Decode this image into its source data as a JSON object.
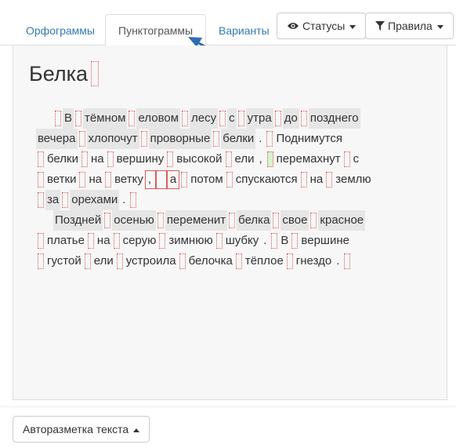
{
  "tabs": [
    {
      "label": "Орфограммы"
    },
    {
      "label": "Пунктограммы"
    },
    {
      "label": "Варианты"
    }
  ],
  "buttons": {
    "statuses_label": "Статусы",
    "rules_label": "Правила",
    "automarkup_label": "Авторазметка текста"
  },
  "icons": {
    "statuses": "eye-icon",
    "rules": "filter-icon"
  },
  "colors": {
    "accent": "#337ab7",
    "slot_border": "#e05a5a",
    "highlight_grey": "#e6e6e6",
    "highlight_green": "#d8f2d0"
  },
  "document": {
    "title": "Белка",
    "lines": [
      [
        {
          "t": "s"
        },
        {
          "t": "w",
          "v": "В"
        },
        {
          "t": "s"
        },
        {
          "t": "w",
          "v": "тёмном"
        },
        {
          "t": "s"
        },
        {
          "t": "w",
          "v": "еловом"
        },
        {
          "t": "s"
        },
        {
          "t": "w",
          "v": "лесу"
        },
        {
          "t": "s"
        },
        {
          "t": "w",
          "v": "с"
        },
        {
          "t": "s"
        },
        {
          "t": "w",
          "v": "утра"
        },
        {
          "t": "s"
        },
        {
          "t": "w",
          "v": "до"
        },
        {
          "t": "s"
        },
        {
          "t": "w",
          "v": "позднего"
        }
      ],
      [
        {
          "t": "w",
          "v": "вечера"
        },
        {
          "t": "s"
        },
        {
          "t": "w",
          "v": "хлопочут"
        },
        {
          "t": "s"
        },
        {
          "t": "w",
          "v": "проворные"
        },
        {
          "t": "s"
        },
        {
          "t": "w",
          "v": "белки"
        },
        {
          "t": "p",
          "v": "."
        },
        {
          "t": "s"
        },
        {
          "t": "w",
          "v": "Поднимутся"
        }
      ],
      [
        {
          "t": "s"
        },
        {
          "t": "w",
          "v": "белки"
        },
        {
          "t": "s"
        },
        {
          "t": "w",
          "v": "на"
        },
        {
          "t": "s"
        },
        {
          "t": "w",
          "v": "вершину"
        },
        {
          "t": "s"
        },
        {
          "t": "w",
          "v": "высокой"
        },
        {
          "t": "s"
        },
        {
          "t": "w",
          "v": "ели"
        },
        {
          "t": "p",
          "v": ","
        },
        {
          "t": "s",
          "g": true
        },
        {
          "t": "w",
          "v": "перемахнут"
        },
        {
          "t": "s"
        },
        {
          "t": "w",
          "v": "с"
        }
      ],
      [
        {
          "t": "s"
        },
        {
          "t": "w",
          "v": "ветки"
        },
        {
          "t": "s"
        },
        {
          "t": "w",
          "v": "на"
        },
        {
          "t": "s"
        },
        {
          "t": "w",
          "v": "ветку"
        },
        {
          "t": "b",
          "v": ","
        },
        {
          "t": "b",
          "v": ""
        },
        {
          "t": "b",
          "v": "а"
        },
        {
          "t": "s"
        },
        {
          "t": "w",
          "v": "потом"
        },
        {
          "t": "s"
        },
        {
          "t": "w",
          "v": "спускаются"
        },
        {
          "t": "s"
        },
        {
          "t": "w",
          "v": "на"
        },
        {
          "t": "s"
        },
        {
          "t": "w",
          "v": "землю"
        }
      ],
      [
        {
          "t": "s"
        },
        {
          "t": "w",
          "v": "за"
        },
        {
          "t": "s"
        },
        {
          "t": "w",
          "v": "орехами"
        },
        {
          "t": "p",
          "v": "."
        },
        {
          "t": "s"
        }
      ],
      [
        {
          "t": "w",
          "v": "Поздней",
          "ind": true
        },
        {
          "t": "s"
        },
        {
          "t": "w",
          "v": "осенью"
        },
        {
          "t": "s"
        },
        {
          "t": "w",
          "v": "переменит"
        },
        {
          "t": "s"
        },
        {
          "t": "w",
          "v": "белка"
        },
        {
          "t": "s"
        },
        {
          "t": "w",
          "v": "свое"
        },
        {
          "t": "s"
        },
        {
          "t": "w",
          "v": "красное"
        }
      ],
      [
        {
          "t": "s"
        },
        {
          "t": "w",
          "v": "платье"
        },
        {
          "t": "s"
        },
        {
          "t": "w",
          "v": "на"
        },
        {
          "t": "s"
        },
        {
          "t": "w",
          "v": "серую"
        },
        {
          "t": "s"
        },
        {
          "t": "w",
          "v": "зимнюю"
        },
        {
          "t": "s"
        },
        {
          "t": "w",
          "v": "шубку"
        },
        {
          "t": "p",
          "v": "."
        },
        {
          "t": "s"
        },
        {
          "t": "w",
          "v": "В"
        },
        {
          "t": "s"
        },
        {
          "t": "w",
          "v": "вершине"
        }
      ],
      [
        {
          "t": "s"
        },
        {
          "t": "w",
          "v": "густой"
        },
        {
          "t": "s"
        },
        {
          "t": "w",
          "v": "ели"
        },
        {
          "t": "s"
        },
        {
          "t": "w",
          "v": "устроила"
        },
        {
          "t": "s"
        },
        {
          "t": "w",
          "v": "белочка"
        },
        {
          "t": "s"
        },
        {
          "t": "w",
          "v": "тёплое"
        },
        {
          "t": "s"
        },
        {
          "t": "w",
          "v": "гнездо"
        },
        {
          "t": "p",
          "v": "."
        },
        {
          "t": "s"
        }
      ]
    ]
  }
}
